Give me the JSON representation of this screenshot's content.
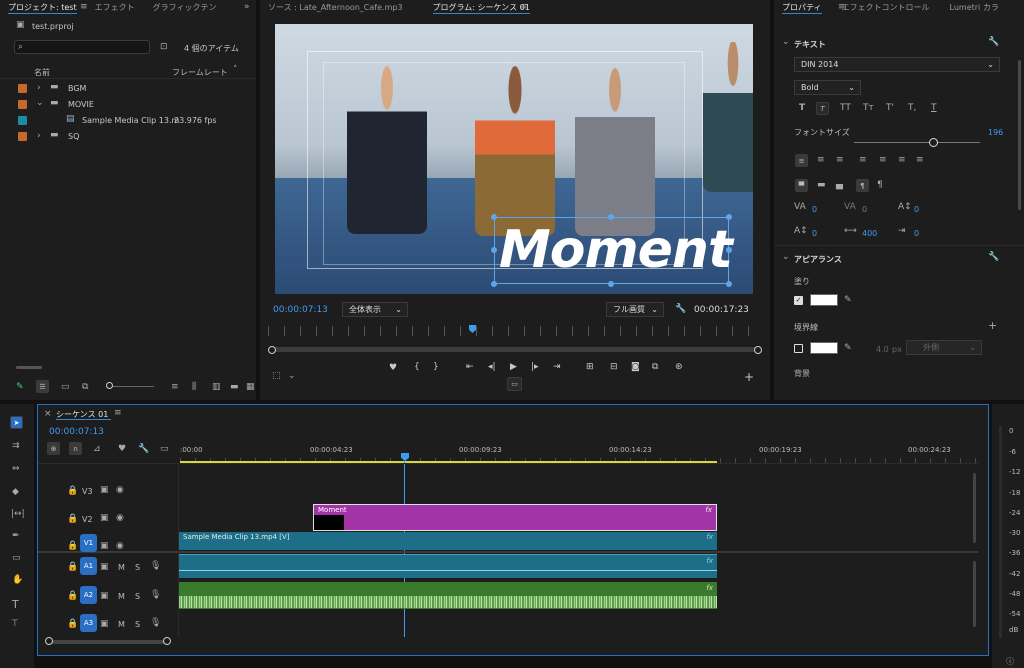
{
  "project": {
    "tabs": [
      "プロジェクト: test",
      "エフェクト",
      "グラフィックテン"
    ],
    "file_name": "test.prproj",
    "item_count": "4 個のアイテム",
    "search_placeholder": "",
    "col_name": "名前",
    "col_framerate": "フレームレート",
    "items": [
      {
        "label": "BGM",
        "color": "#c8682b",
        "type": "folder",
        "expanded": false
      },
      {
        "label": "MOVIE",
        "color": "#c8682b",
        "type": "folder",
        "expanded": true
      },
      {
        "label": "Sample Media Clip 13.m",
        "fps": "23.976 fps",
        "color": "#1e8aa7",
        "type": "clip"
      },
      {
        "label": "SQ",
        "color": "#c8682b",
        "type": "folder",
        "expanded": false
      }
    ]
  },
  "monitor": {
    "source_tab": "ソース : Late_Afternoon_Cafe.mp3",
    "program_tab": "プログラム: シーケンス 01",
    "overlay_text": "Moment",
    "timecode_current": "00:00:07:13",
    "fit_label": "全体表示",
    "quality_label": "フル画質",
    "timecode_duration": "00:00:17:23",
    "playhead_fraction": 0.413
  },
  "properties": {
    "tabs": [
      "プロパティ",
      "エフェクトコントロール",
      "Lumetri カラ"
    ],
    "text_section": "テキスト",
    "font_family": "DIN 2014",
    "font_style": "Bold",
    "font_size_label": "フォントサイズ",
    "font_size_value": "196",
    "font_size_fraction": 0.5,
    "text_styles": [
      "T",
      "T",
      "TT",
      "Tт",
      "T'",
      "T,",
      "T"
    ],
    "kerning_value": "0",
    "tracking_value": "0",
    "baseline_value": "0",
    "leading_value": "0",
    "tsume_value": "400",
    "tab_value": "0",
    "appearance_section": "アピアランス",
    "fill_label": "塗り",
    "fill_color": "#ffffff",
    "stroke_label": "境界線",
    "stroke_color": "#ffffff",
    "stroke_width": "4.0",
    "stroke_unit": "px",
    "stroke_position": "外側",
    "shadow_label": "背景"
  },
  "timeline": {
    "sequence_tab": "シーケンス 01",
    "timecode": "00:00:07:13",
    "ruler_ticks": [
      ":00:00",
      "00:00:04:23",
      "00:00:09:23",
      "00:00:14:23",
      "00:00:19:23",
      "00:00:24:23"
    ],
    "playhead_fraction": 0.285,
    "video_tracks": [
      "V3",
      "V2",
      "V1"
    ],
    "audio_tracks": [
      "A1",
      "A2",
      "A3"
    ],
    "clip_moment": "Moment",
    "clip_v1": "Sample Media Clip 13.mp4 [V]",
    "fx": "fx",
    "track_m": "M",
    "track_s": "S"
  },
  "meter": {
    "labels": [
      "0",
      "-6",
      "-12",
      "-18",
      "-24",
      "-30",
      "-36",
      "-42",
      "-48",
      "-54",
      "dB"
    ]
  },
  "colors": {
    "accent": "#2b8bd6",
    "clip_pink": "#a334a8",
    "clip_blue": "#1c6f87",
    "clip_green": "#3a7a2c"
  }
}
